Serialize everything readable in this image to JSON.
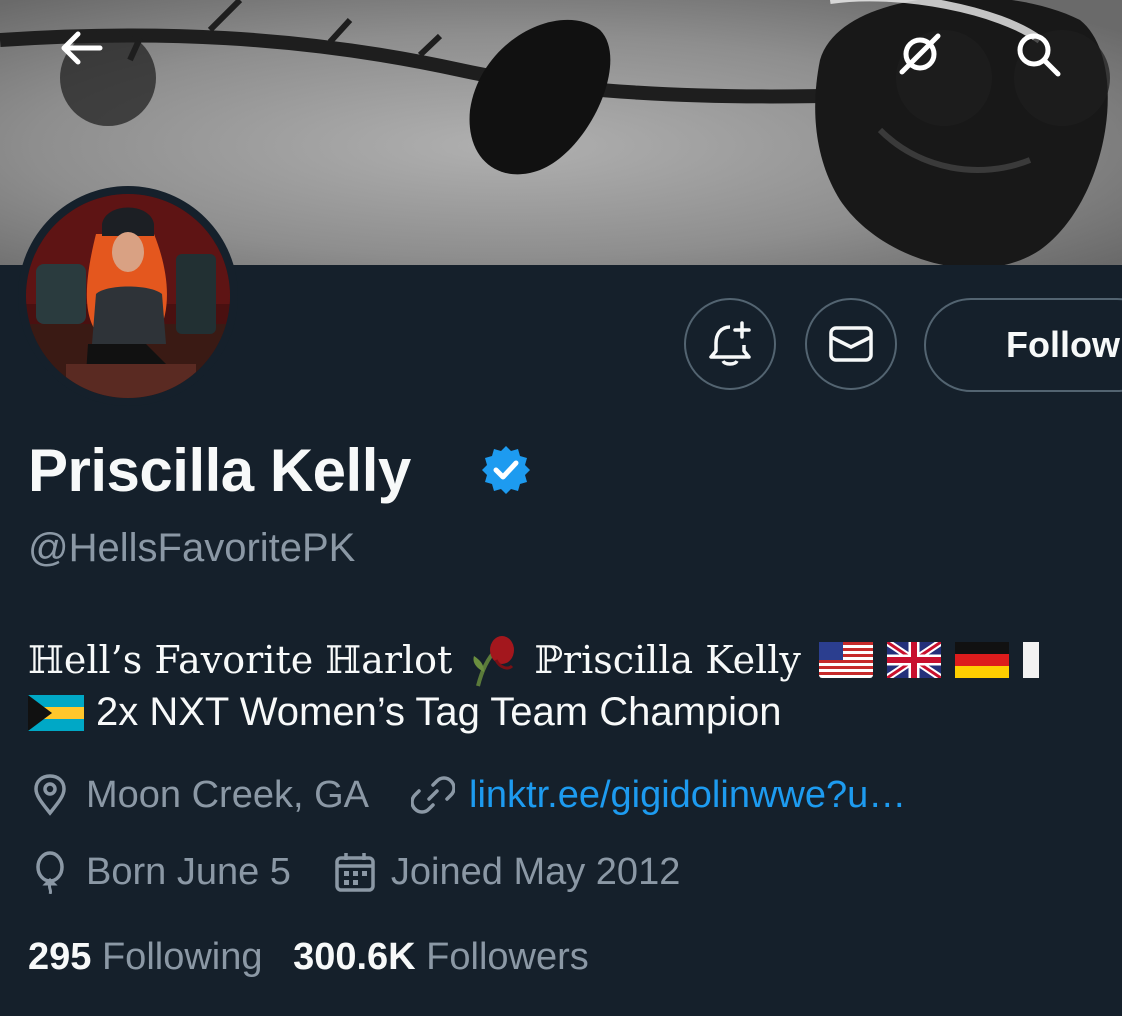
{
  "profile": {
    "display_name": "Priscilla Kelly",
    "handle": "@HellsFavoritePK",
    "bio_line1": "ℍell’s Favorite ℍarlot",
    "bio_line1_name": "ℙriscilla Kelly",
    "bio_line2": "2x NXT Women’s Tag Team Champion",
    "location": "Moon Creek, GA",
    "website": "linktr.ee/gigidolinwwe?u…",
    "birthday": "Born June 5",
    "joined": "Joined May 2012",
    "following_count": "295",
    "following_label": "Following",
    "followers_count": "300.6K",
    "followers_label": "Followers"
  },
  "actions": {
    "follow_label": "Follow"
  },
  "icons": {
    "back": "back-arrow-icon",
    "grok": "grok-icon",
    "search": "search-icon",
    "notify": "bell-plus-icon",
    "message": "envelope-icon",
    "verified": "verified-badge-icon",
    "location": "location-pin-icon",
    "link": "link-icon",
    "birthday": "balloon-icon",
    "calendar": "calendar-icon",
    "bio_emoji": "wilted-rose-emoji",
    "flags": [
      "us-flag",
      "uk-flag",
      "germany-flag",
      "partial-flag",
      "bahamas-flag"
    ]
  },
  "colors": {
    "background": "#15202b",
    "accent": "#1d9bf0",
    "secondary_text": "#8b98a5",
    "primary_text": "#f7f9f9"
  }
}
